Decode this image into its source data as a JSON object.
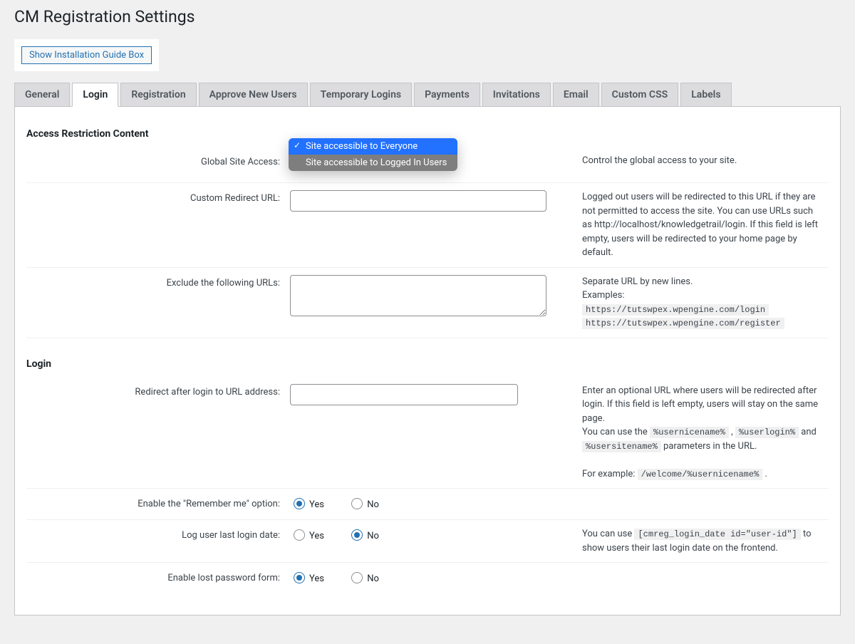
{
  "page_title": "CM Registration Settings",
  "guide_button": "Show Installation Guide Box",
  "tabs": [
    "General",
    "Login",
    "Registration",
    "Approve New Users",
    "Temporary Logins",
    "Payments",
    "Invitations",
    "Email",
    "Custom CSS",
    "Labels"
  ],
  "active_tab": 1,
  "section1_title": "Access Restriction Content",
  "section2_title": "Login",
  "rows": {
    "global_access": {
      "label": "Global Site Access:",
      "options": [
        "Site accessible to Everyone",
        "Site accessible to Logged In Users"
      ],
      "selected_index": 0,
      "desc": "Control the global access to your site."
    },
    "custom_redirect": {
      "label": "Custom Redirect URL:",
      "value": "",
      "desc": "Logged out users will be redirected to this URL if they are not permitted to access the site. You can use URLs such as http://localhost/knowledgetrail/login. If this field is left empty, users will be redirected to your home page by default."
    },
    "exclude_urls": {
      "label": "Exclude the following URLs:",
      "value": "",
      "desc_line1": "Separate URL by new lines.",
      "desc_line2": "Examples:",
      "example1": "https://tutswpex.wpengine.com/login",
      "example2": "https://tutswpex.wpengine.com/register"
    },
    "redirect_after_login": {
      "label": "Redirect after login to URL address:",
      "value": "",
      "desc_p1": "Enter an optional URL where users will be redirected after login. If this field is left empty, users will stay on the same page.",
      "desc_p2a": "You can use the ",
      "code1": "%usernicename%",
      "sep": " , ",
      "code2": "%userlogin%",
      "and": " and ",
      "code3": "%usersitename%",
      "desc_p2b": " parameters in the URL.",
      "desc_p3a": "For example: ",
      "code4": "/welcome/%usernicename%",
      "desc_p3b": " ."
    },
    "remember_me": {
      "label": "Enable the \"Remember me\" option:",
      "yes": "Yes",
      "no": "No",
      "value": "yes"
    },
    "log_last_login": {
      "label": "Log user last login date:",
      "yes": "Yes",
      "no": "No",
      "value": "no",
      "desc_a": "You can use ",
      "code": "[cmreg_login_date id=\"user-id\"]",
      "desc_b": " to show users their last login date on the frontend."
    },
    "lost_password": {
      "label": "Enable lost password form:",
      "yes": "Yes",
      "no": "No",
      "value": "yes"
    }
  }
}
